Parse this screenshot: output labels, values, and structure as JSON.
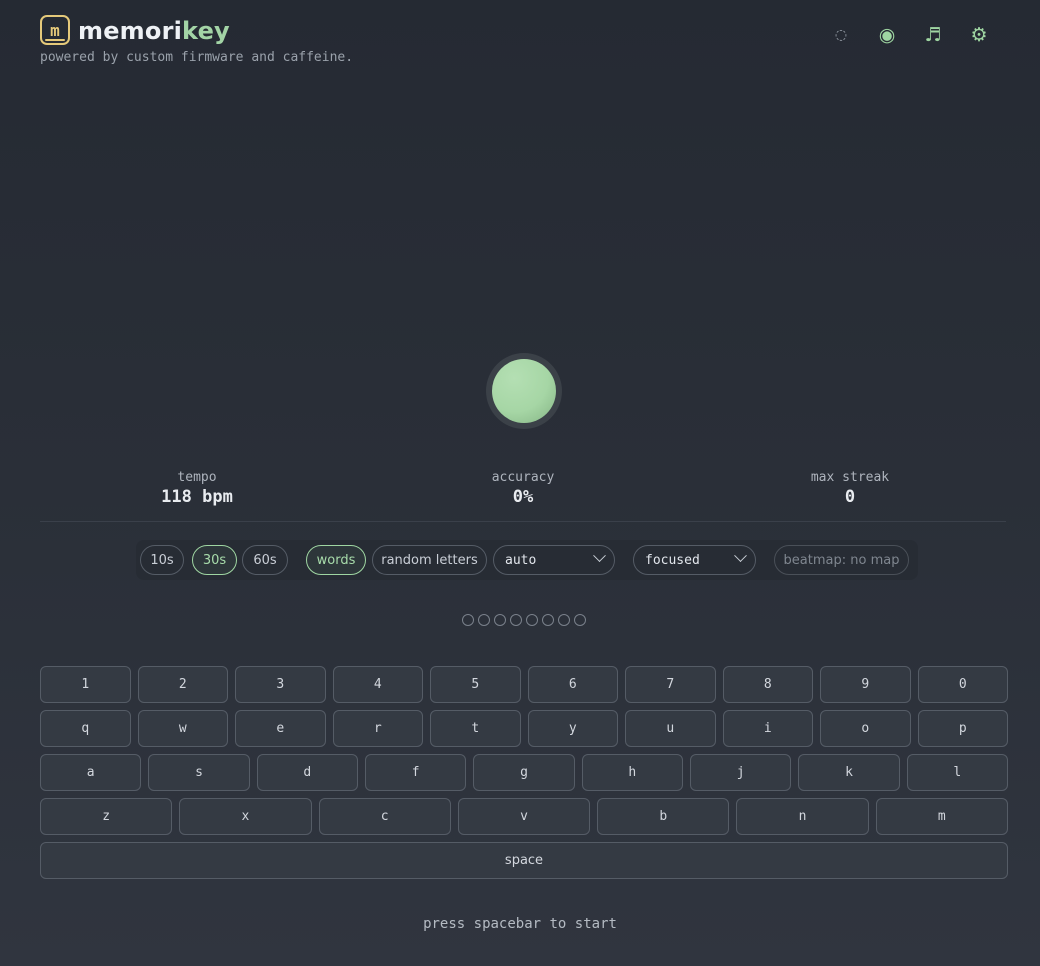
{
  "app": {
    "name_prefix": "memori",
    "name_suffix": "key",
    "tagline": "powered by custom firmware and caffeine.",
    "logo_letter": "m"
  },
  "top_icons": [
    {
      "name": "loading-ring-icon",
      "glyph": "◌"
    },
    {
      "name": "record-icon",
      "glyph": "◉"
    },
    {
      "name": "music-note-icon",
      "glyph": "♬"
    },
    {
      "name": "gear-icon",
      "glyph": "⚙"
    }
  ],
  "stats": {
    "tempo": {
      "label": "tempo",
      "value": "118 bpm"
    },
    "accuracy": {
      "label": "accuracy",
      "value": "0%"
    },
    "max_streak": {
      "label": "max streak",
      "value": "0"
    }
  },
  "controls": {
    "durations": [
      "10s",
      "30s",
      "60s"
    ],
    "selected_duration": "30s",
    "modes": [
      "words",
      "random letters"
    ],
    "selected_mode": "words",
    "tempo_select": "auto",
    "view_select": "focused",
    "beatmap": "beatmap: no map"
  },
  "progress_dots": 8,
  "keyboard": {
    "row1": [
      "1",
      "2",
      "3",
      "4",
      "5",
      "6",
      "7",
      "8",
      "9",
      "0"
    ],
    "row2": [
      "q",
      "w",
      "e",
      "r",
      "t",
      "y",
      "u",
      "i",
      "o",
      "p"
    ],
    "row3": [
      "a",
      "s",
      "d",
      "f",
      "g",
      "h",
      "j",
      "k",
      "l"
    ],
    "row4": [
      "z",
      "x",
      "c",
      "v",
      "b",
      "n",
      "m"
    ],
    "space": "space"
  },
  "hint": "press spacebar to start",
  "colors": {
    "accent": "#a3d4a6",
    "logo": "#e5c97a",
    "background": "#2a2f38"
  }
}
